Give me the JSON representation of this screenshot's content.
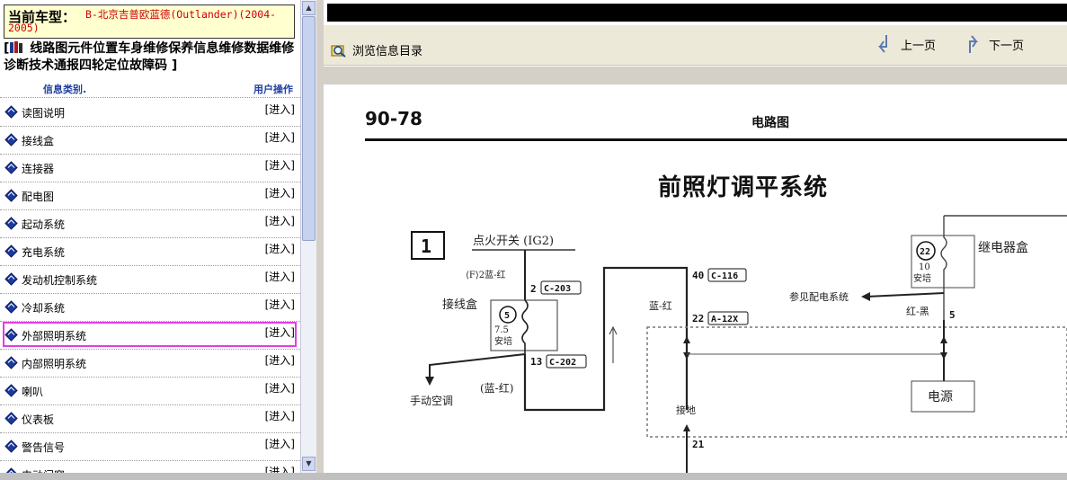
{
  "left": {
    "vehicle_label": "当前车型：",
    "vehicle_value": "B-北京吉普欧蓝德(Outlander)(2004-2005)",
    "nav_open": "[",
    "nav_links": "线路图元件位置车身维修保养信息维修数据维修诊断技术通报四轮定位故障码",
    "nav_close": "]",
    "col_category": "信息类别.",
    "col_action": "用户操作",
    "enter_label": "[进入]",
    "items": [
      {
        "name": "读图说明"
      },
      {
        "name": "接线盒"
      },
      {
        "name": "连接器"
      },
      {
        "name": "配电图"
      },
      {
        "name": "起动系统"
      },
      {
        "name": "充电系统"
      },
      {
        "name": "发动机控制系统"
      },
      {
        "name": "冷却系统"
      },
      {
        "name": "外部照明系统"
      },
      {
        "name": "内部照明系统"
      },
      {
        "name": "喇叭"
      },
      {
        "name": "仪表板"
      },
      {
        "name": "警告信号"
      },
      {
        "name": "电动门窗"
      }
    ],
    "selected_item": "外部照明系统"
  },
  "right": {
    "browse_label": "浏览信息目录",
    "prev_label": "上一页",
    "next_label": "下一页",
    "page_number": "90-78",
    "section": "电路图",
    "title": "前照灯调平系统",
    "diagram": {
      "box_number": "1",
      "ignition": "点火开关 (IG2)",
      "wire1": "⟨F⟩2蓝-红",
      "pin1": "2",
      "conn1": "C-203",
      "jb_label": "接线盒",
      "fuse_num": "5",
      "fuse_rating": "7.5",
      "fuse_unit": "安培",
      "pin2": "13",
      "conn2": "C-202",
      "ac_label": "手动空调",
      "wire2": "(蓝-红)",
      "pin3": "40",
      "conn3": "C-116",
      "wire3": "蓝-红",
      "pin4": "22",
      "conn4": "A-12X",
      "relay_num": "22",
      "relay_rating": "10",
      "relay_unit": "安培",
      "relay_box": "继电器盒",
      "see_power": "参见配电系统",
      "wire4": "红-黑",
      "pin5": "5",
      "power": "电源",
      "ground": "接地",
      "pin6": "21"
    }
  },
  "colors": {
    "vehicle_bg": "#ffffd0",
    "vehicle_value": "#cc0000",
    "header_blue": "#1f3f9f",
    "selection": "#e040e0",
    "toolbar": "#ece9d8"
  }
}
